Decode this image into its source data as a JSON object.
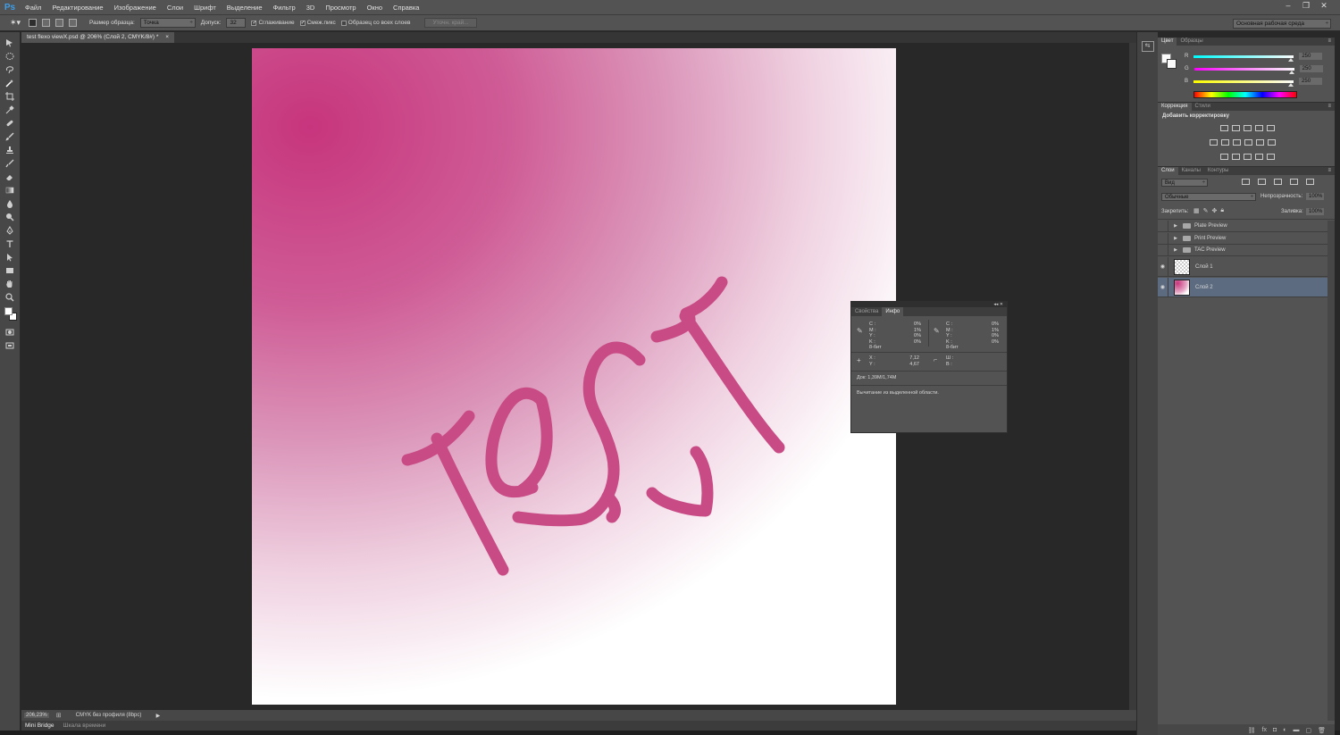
{
  "app": {
    "logo": "Ps",
    "menu": [
      "Файл",
      "Редактирование",
      "Изображение",
      "Слои",
      "Шрифт",
      "Выделение",
      "Фильтр",
      "3D",
      "Просмотр",
      "Окно",
      "Справка"
    ],
    "window_controls": [
      "–",
      "❐",
      "✕"
    ]
  },
  "options_bar": {
    "sample_size_label": "Размер образца:",
    "sample_size_value": "Точка",
    "tolerance_label": "Допуск:",
    "tolerance_value": "32",
    "anti_alias_label": "Сглаживание",
    "contiguous_label": "Смеж.пикс",
    "sample_all_label": "Образец со всех слоев",
    "refine_edge_label": "Уточн. край...",
    "workspace_value": "Основная рабочая среда"
  },
  "document": {
    "tab_title": "test flexo viewX.psd @ 206% (Слой 2, CMYK/8#) *",
    "tab_close": "×",
    "artwork_text": "TEST",
    "ink_color": "#c84b85",
    "gradient_color": "#c7357d"
  },
  "status_bar": {
    "zoom": "206,23%",
    "profile": "CMYK без профиля (8bpc)",
    "arrow": "▶"
  },
  "bottom_tabs": [
    "Mini Bridge",
    "Шкала времени"
  ],
  "color_panel": {
    "tabs": [
      "Цвет",
      "Образцы"
    ],
    "channels": [
      {
        "label": "R",
        "value": "250"
      },
      {
        "label": "G",
        "value": "250"
      },
      {
        "label": "B",
        "value": "250"
      }
    ]
  },
  "adjustments_panel": {
    "tabs": [
      "Коррекция",
      "Стили"
    ],
    "title": "Добавить корректировку"
  },
  "layers_panel": {
    "tabs": [
      "Слои",
      "Каналы",
      "Контуры"
    ],
    "filter_value": "Вид",
    "blend_mode": "Обычные",
    "opacity_label": "Непрозрачность:",
    "opacity_value": "100%",
    "lock_label": "Закрепить:",
    "fill_label": "Заливка:",
    "fill_value": "100%",
    "layers": [
      {
        "name": "Plate Preview",
        "type": "group",
        "visible": false
      },
      {
        "name": "Print Preview",
        "type": "group",
        "visible": false
      },
      {
        "name": "TAC Preview",
        "type": "group",
        "visible": false
      },
      {
        "name": "Слой 1",
        "type": "layer",
        "visible": true
      },
      {
        "name": "Слой 2",
        "type": "layer",
        "visible": true,
        "selected": true
      }
    ]
  },
  "info_panel": {
    "tabs": [
      "Свойства",
      "Инфо"
    ],
    "cmyk_labels": [
      "C :",
      "M :",
      "Y :",
      "K :",
      "8-бит"
    ],
    "cmyk_values_left": [
      "0%",
      "1%",
      "0%",
      "0%"
    ],
    "cmyk_values_right": [
      "0%",
      "1%",
      "0%",
      "0%"
    ],
    "xy_labels": [
      "X :",
      "Y :"
    ],
    "xy_values": [
      "7,12",
      "4,67"
    ],
    "wh_labels": [
      "Ш :",
      "В :"
    ],
    "doc_size": "Док: 1,39M/1,74M",
    "hint": "Вычитание из выделенной области."
  }
}
